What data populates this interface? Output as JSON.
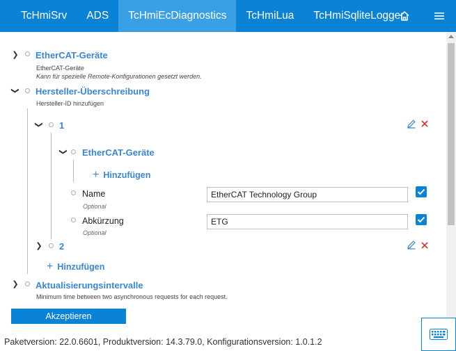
{
  "nav": {
    "tabs": [
      {
        "label": "TcHmiSrv"
      },
      {
        "label": "ADS"
      },
      {
        "label": "TcHmiEcDiagnostics"
      },
      {
        "label": "TcHmiLua"
      },
      {
        "label": "TcHmiSqliteLogger"
      }
    ],
    "active_index": 2,
    "home_icon": "home-icon",
    "menu_icon": "hamburger-menu-icon"
  },
  "tree": {
    "ethercat_devices": {
      "title": "EtherCAT-Geräte",
      "desc": "EtherCAT-Geräte",
      "desc2": "Kann für spezielle Remote-Konfigurationen gesetzt werden."
    },
    "vendor_override": {
      "title": "Hersteller-Überschreibung",
      "desc": "Hersteller-ID hinzufügen",
      "item1": {
        "title": "1",
        "sub_title": "EtherCAT-Geräte",
        "add_label": "Hinzufügen",
        "name_label": "Name",
        "name_optional": "Optional",
        "name_value": "EtherCAT Technology Group",
        "abbr_label": "Abkürzung",
        "abbr_optional": "Optional",
        "abbr_value": "ETG"
      },
      "item2": {
        "title": "2"
      },
      "add_label": "Hinzufügen"
    },
    "update_intervals": {
      "title": "Aktualisierungsintervalle",
      "desc": "Minimum time between two asynchronous requests for each request."
    }
  },
  "accept_label": "Akzeptieren",
  "footer": "Paketversion: 22.0.6601, Produktversion: 14.3.79.0, Konfigurationsversion: 1.0.1.2",
  "colors": {
    "accent": "#0a82d6",
    "link": "#3a86d6",
    "delete": "#d9302c"
  }
}
